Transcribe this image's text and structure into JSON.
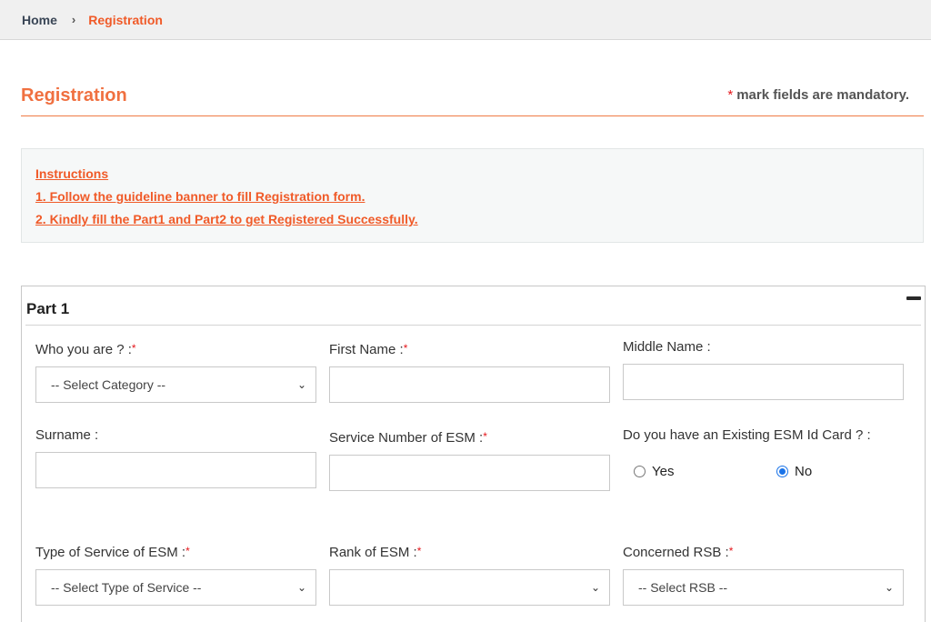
{
  "breadcrumb": {
    "home": "Home",
    "separator": "›",
    "current": "Registration"
  },
  "header": {
    "title": "Registration",
    "mandatory_star": "*",
    "mandatory_note": "mark fields are mandatory."
  },
  "instructions": {
    "heading": "Instructions",
    "items": [
      "1. Follow the guideline banner to fill Registration form.",
      "2. Kindly fill the Part1 and Part2 to get Registered Successfully."
    ]
  },
  "part1": {
    "title": "Part 1",
    "collapse_icon": "minus-icon",
    "required_mark": "*",
    "fields": {
      "who_you_are": {
        "label": "Who you are ? :",
        "required": true,
        "value": "-- Select Category --"
      },
      "first_name": {
        "label": "First Name :",
        "required": true,
        "value": ""
      },
      "middle_name": {
        "label": "Middle Name :",
        "required": false,
        "value": ""
      },
      "surname": {
        "label": "Surname :",
        "required": false,
        "value": ""
      },
      "service_number": {
        "label": "Service Number of ESM :",
        "required": true,
        "value": ""
      },
      "existing_id_card": {
        "label": "Do you have an Existing ESM Id Card ? :",
        "options": [
          "Yes",
          "No"
        ],
        "selected": "No"
      },
      "type_of_service": {
        "label": "Type of Service of ESM :",
        "required": true,
        "value": "-- Select Type of Service --"
      },
      "rank": {
        "label": "Rank of ESM :",
        "required": true,
        "value": ""
      },
      "concerned_rsb": {
        "label": "Concerned RSB :",
        "required": true,
        "value": "-- Select RSB --"
      }
    }
  },
  "colors": {
    "accent": "#f05a28",
    "required": "#e5161b",
    "radio_selected": "#1a73e8"
  }
}
